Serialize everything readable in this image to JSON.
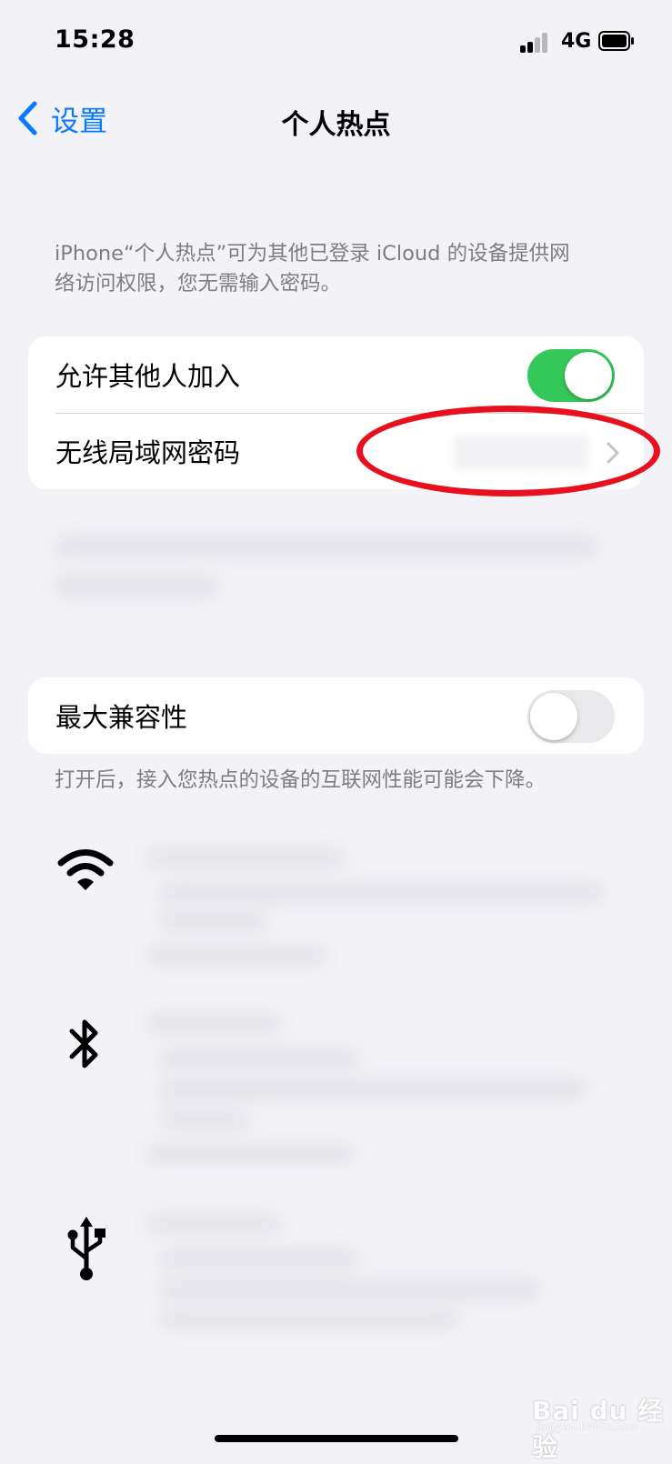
{
  "status_bar": {
    "time": "15:28",
    "network": "4G"
  },
  "nav": {
    "back_label": "设置",
    "title": "个人热点"
  },
  "intro_text_line1": "iPhone“个人热点”可为其他已登录 iCloud 的设备提供网",
  "intro_text_line2": "络访问权限，您无需输入密码。",
  "hotspot_section": {
    "allow_others_label": "允许其他人加入",
    "allow_others_on": true,
    "wifi_password_label": "无线局域网密码"
  },
  "compat_section": {
    "max_compat_label": "最大兼容性",
    "max_compat_on": false,
    "footnote": "打开后，接入您热点的设备的互联网性能可能会下降。"
  },
  "connection_icons": [
    "wifi-icon",
    "bluetooth-icon",
    "usb-icon"
  ],
  "watermark": {
    "text": "Bai du 经验",
    "sub": "jingyan.baidu.com"
  },
  "colors": {
    "accent": "#0a7aff",
    "toggle_on": "#34c759",
    "annotation_red": "#e8101c"
  }
}
